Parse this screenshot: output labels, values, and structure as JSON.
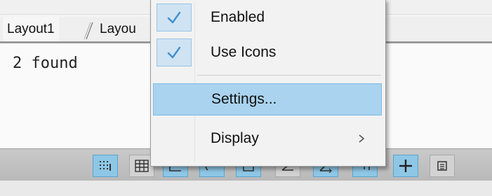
{
  "layout_tabs": [
    {
      "label": "Layout1"
    },
    {
      "label": "Layou"
    }
  ],
  "command_line": {
    "output": "2 found"
  },
  "context_menu": {
    "items": [
      {
        "label": "Enabled",
        "checked": true,
        "icon": "checkmark-icon"
      },
      {
        "label": "Use Icons",
        "checked": true,
        "icon": "checkmark-icon"
      },
      {
        "label": "Settings...",
        "highlighted": true
      },
      {
        "label": "Display",
        "has_submenu": true,
        "icon": "chevron-right-icon"
      }
    ]
  },
  "status_bar": {
    "buttons": [
      {
        "icon": "grid-snap-icon",
        "state": "on"
      },
      {
        "icon": "grid-display-icon",
        "state": "off"
      },
      {
        "icon": "ortho-mode-icon",
        "state": "on"
      },
      {
        "icon": "polar-tracking-icon",
        "state": "on"
      },
      {
        "icon": "object-snap-icon",
        "state": "on"
      },
      {
        "icon": "angle-icon",
        "state": "off"
      },
      {
        "icon": "dynamic-ucs-icon",
        "state": "on"
      },
      {
        "icon": "dynamic-input-icon",
        "state": "on"
      },
      {
        "icon": "lineweight-icon",
        "state": "on"
      },
      {
        "icon": "quick-properties-icon",
        "state": "off"
      }
    ]
  },
  "colors": {
    "menu_highlight": "#a9d3ef",
    "check_bg": "#cfe3f3",
    "check_mark": "#3f8fcf",
    "status_on": "#8ec7e6",
    "status_off": "#d2d2d2"
  }
}
